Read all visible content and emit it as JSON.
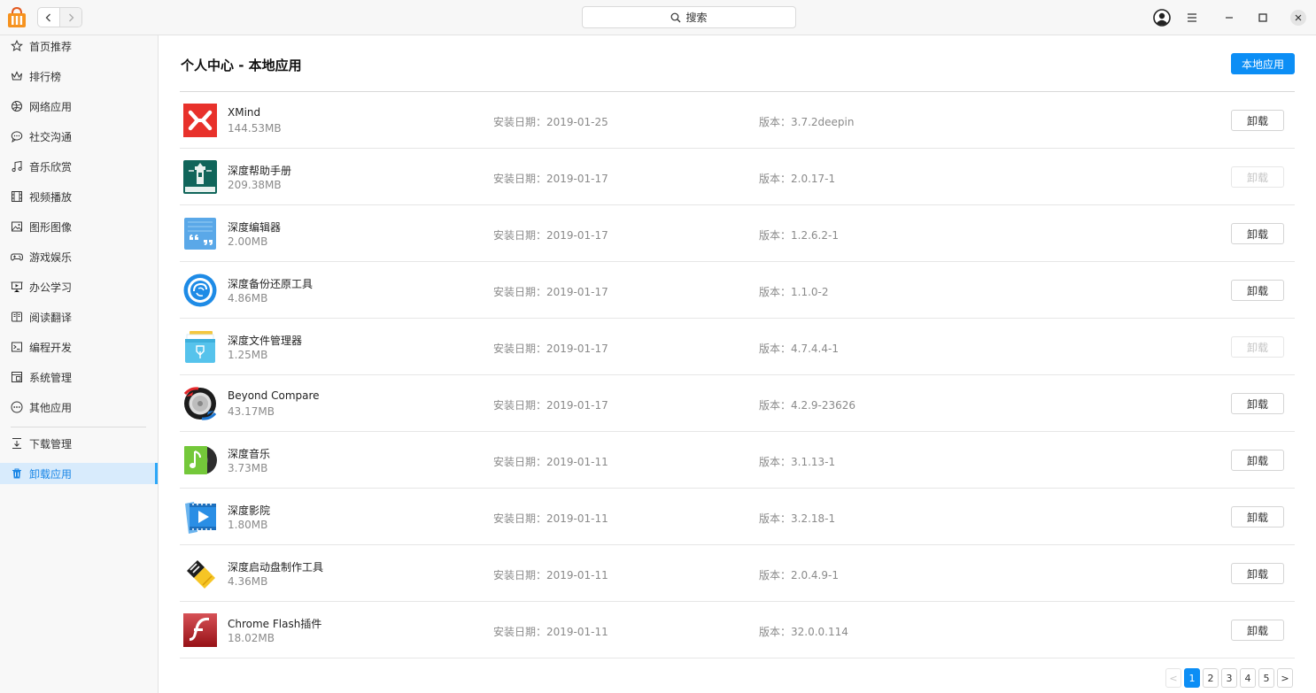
{
  "titlebar": {
    "search_label": "搜索"
  },
  "sidebar": {
    "items": [
      {
        "label": "首页推荐",
        "icon": "star-icon"
      },
      {
        "label": "排行榜",
        "icon": "crown-icon"
      },
      {
        "label": "网络应用",
        "icon": "globe-icon"
      },
      {
        "label": "社交沟通",
        "icon": "chat-icon"
      },
      {
        "label": "音乐欣赏",
        "icon": "music-icon"
      },
      {
        "label": "视频播放",
        "icon": "film-icon"
      },
      {
        "label": "图形图像",
        "icon": "image-icon"
      },
      {
        "label": "游戏娱乐",
        "icon": "gamepad-icon"
      },
      {
        "label": "办公学习",
        "icon": "presentation-icon"
      },
      {
        "label": "阅读翻译",
        "icon": "book-icon"
      },
      {
        "label": "编程开发",
        "icon": "terminal-icon"
      },
      {
        "label": "系统管理",
        "icon": "system-icon"
      },
      {
        "label": "其他应用",
        "icon": "more-icon"
      },
      {
        "label": "下载管理",
        "icon": "download-icon"
      },
      {
        "label": "卸载应用",
        "icon": "trash-icon"
      }
    ]
  },
  "main": {
    "title": "个人中心 - 本地应用",
    "local_button": "本地应用",
    "apps": [
      {
        "name": "XMind",
        "size": "144.53MB",
        "date": "安装日期：2019-01-25",
        "version": "版本：3.7.2deepin",
        "button": "卸载",
        "disabled": false
      },
      {
        "name": "深度帮助手册",
        "size": "209.38MB",
        "date": "安装日期：2019-01-17",
        "version": "版本：2.0.17-1",
        "button": "卸载",
        "disabled": true
      },
      {
        "name": "深度编辑器",
        "size": "2.00MB",
        "date": "安装日期：2019-01-17",
        "version": "版本：1.2.6.2-1",
        "button": "卸载",
        "disabled": false
      },
      {
        "name": "深度备份还原工具",
        "size": "4.86MB",
        "date": "安装日期：2019-01-17",
        "version": "版本：1.1.0-2",
        "button": "卸载",
        "disabled": false
      },
      {
        "name": "深度文件管理器",
        "size": "1.25MB",
        "date": "安装日期：2019-01-17",
        "version": "版本：4.7.4.4-1",
        "button": "卸载",
        "disabled": true
      },
      {
        "name": "Beyond Compare",
        "size": "43.17MB",
        "date": "安装日期：2019-01-17",
        "version": "版本：4.2.9-23626",
        "button": "卸载",
        "disabled": false
      },
      {
        "name": "深度音乐",
        "size": "3.73MB",
        "date": "安装日期：2019-01-11",
        "version": "版本：3.1.13-1",
        "button": "卸载",
        "disabled": false
      },
      {
        "name": "深度影院",
        "size": "1.80MB",
        "date": "安装日期：2019-01-11",
        "version": "版本：3.2.18-1",
        "button": "卸载",
        "disabled": false
      },
      {
        "name": "深度启动盘制作工具",
        "size": "4.36MB",
        "date": "安装日期：2019-01-11",
        "version": "版本：2.0.4.9-1",
        "button": "卸载",
        "disabled": false
      },
      {
        "name": "Chrome Flash插件",
        "size": "18.02MB",
        "date": "安装日期：2019-01-11",
        "version": "版本：32.0.0.114",
        "button": "卸载",
        "disabled": false
      }
    ]
  },
  "pager": {
    "prev": "<",
    "pages": [
      "1",
      "2",
      "3",
      "4",
      "5"
    ],
    "current": "1",
    "next": ">"
  }
}
